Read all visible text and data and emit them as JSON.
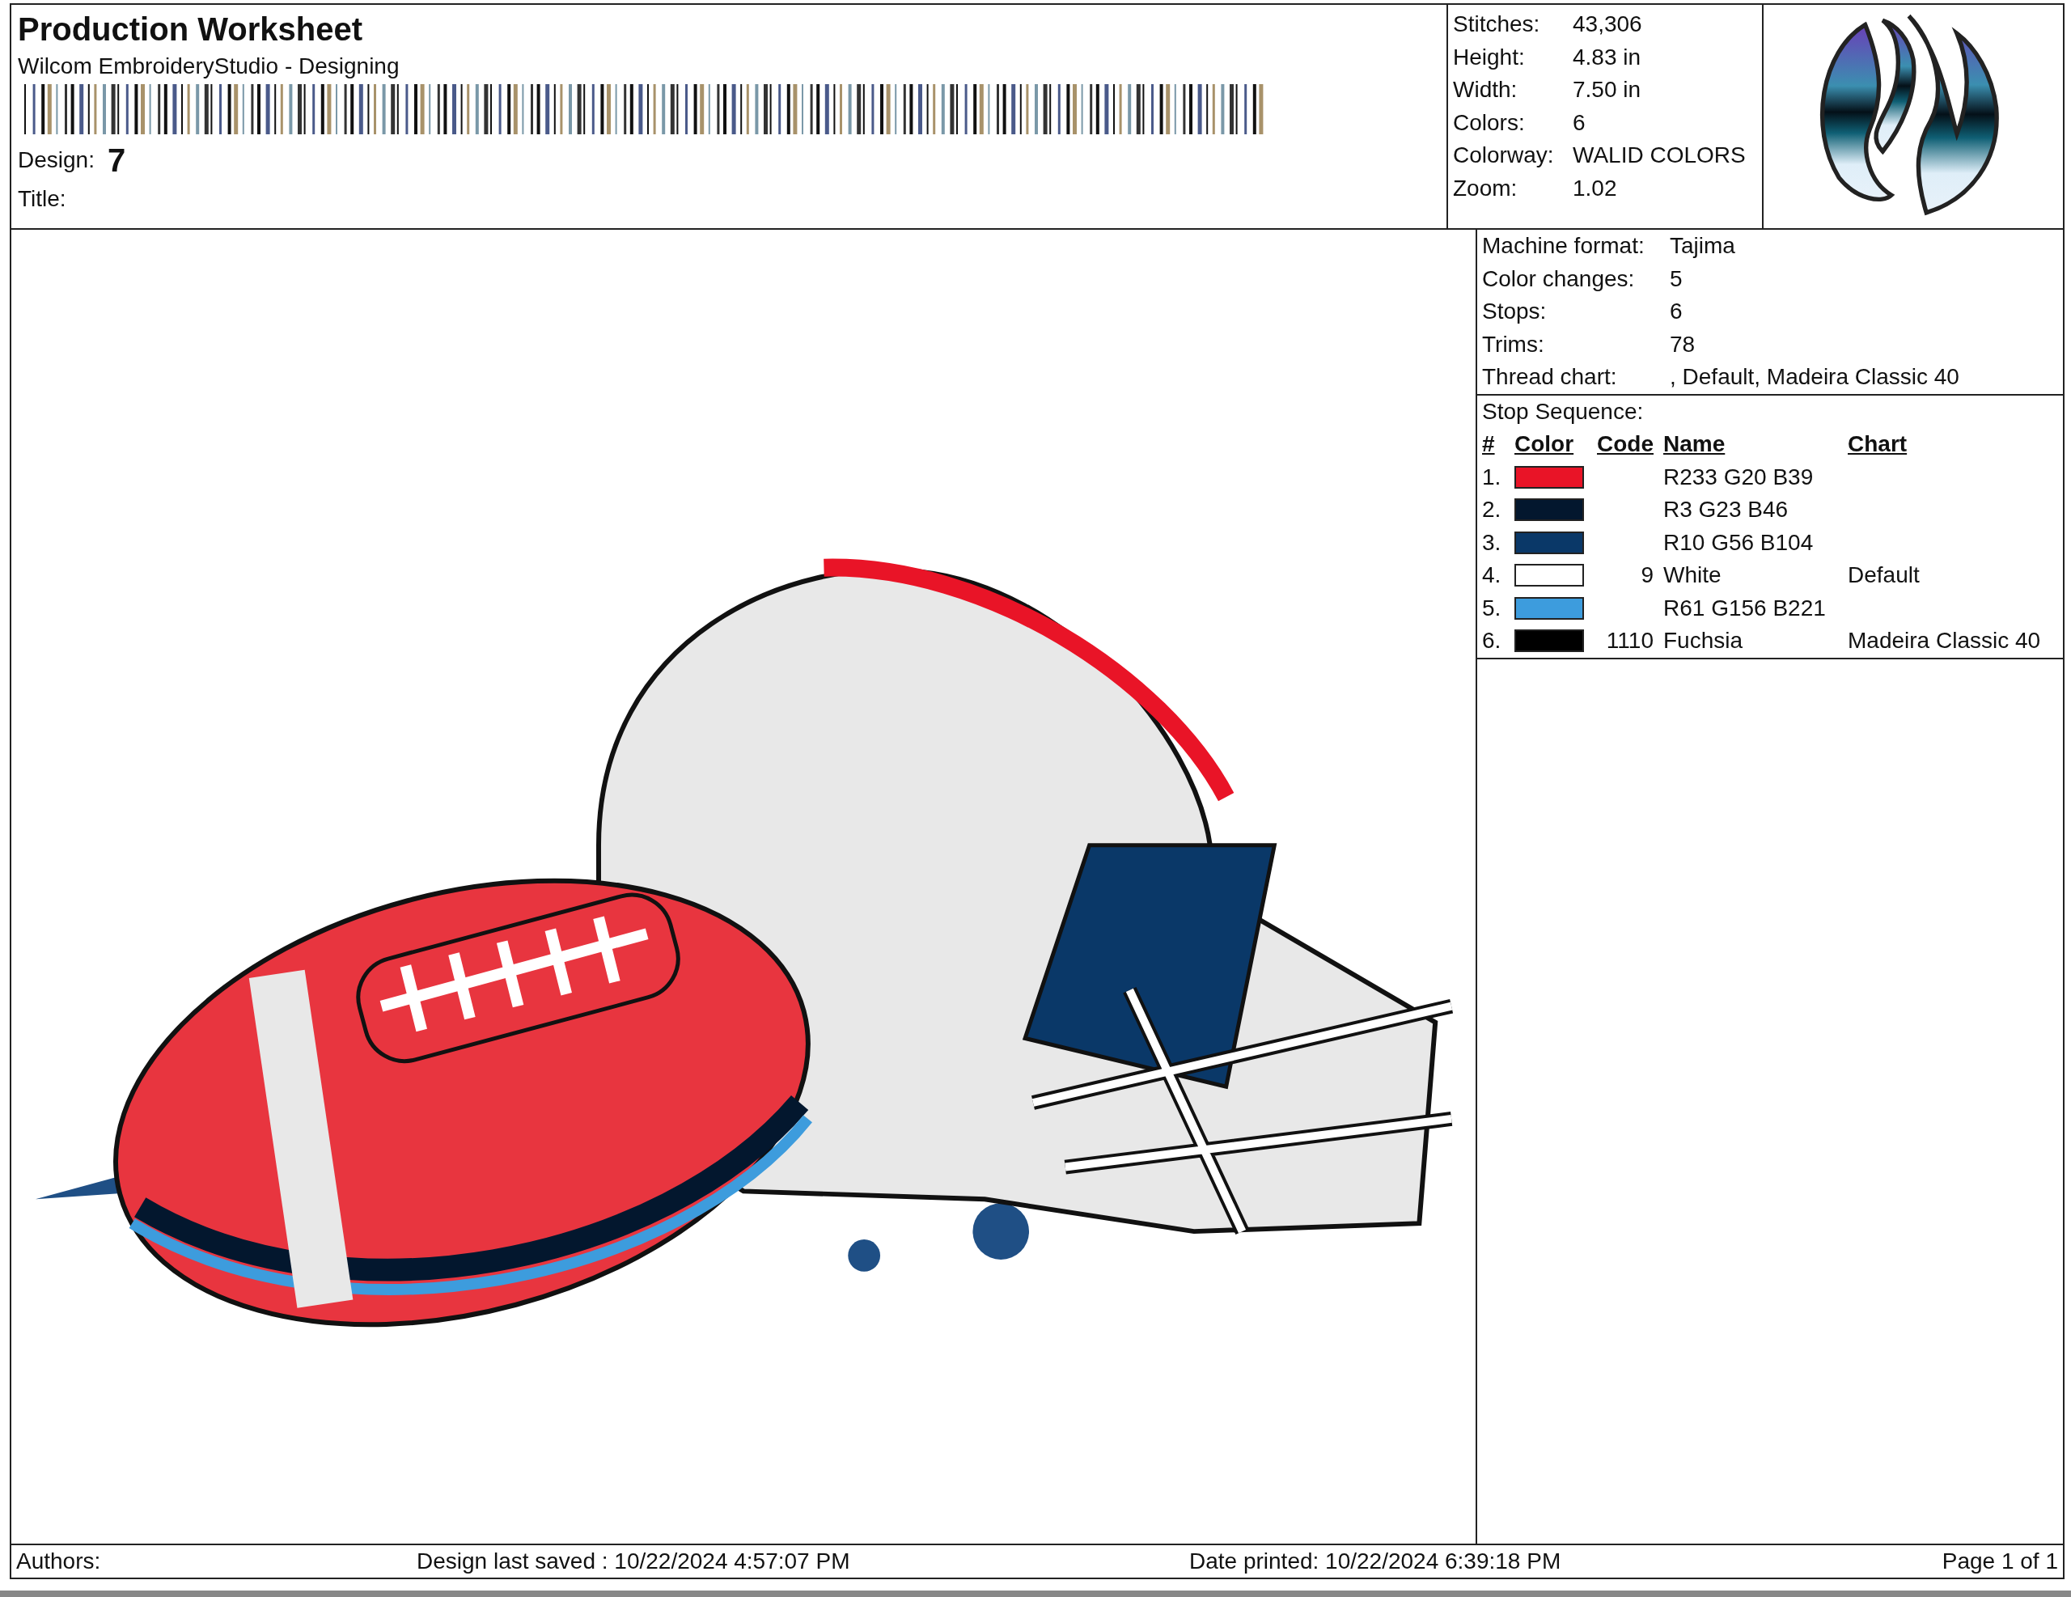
{
  "header": {
    "title": "Production Worksheet",
    "subtitle": "Wilcom EmbroideryStudio - Designing",
    "design_label": "Design:",
    "design_value": "7",
    "title_label": "Title:"
  },
  "stats": [
    {
      "label": "Stitches:",
      "value": "43,306"
    },
    {
      "label": "Height:",
      "value": "4.83 in"
    },
    {
      "label": "Width:",
      "value": "7.50 in"
    },
    {
      "label": "Colors:",
      "value": "6"
    },
    {
      "label": "Colorway:",
      "value": "WALID COLORS"
    },
    {
      "label": "Zoom:",
      "value": "1.02"
    }
  ],
  "machine": [
    {
      "label": "Machine format:",
      "value": "Tajima"
    },
    {
      "label": "Color changes:",
      "value": "5"
    },
    {
      "label": "Stops:",
      "value": "6"
    },
    {
      "label": "Trims:",
      "value": "78"
    },
    {
      "label": "Thread chart:",
      "value": ", Default, Madeira Classic 40"
    }
  ],
  "stop_sequence": {
    "title": "Stop Sequence:",
    "columns": [
      "#",
      "Color",
      "Code",
      "Name",
      "Chart"
    ],
    "rows": [
      {
        "number": "1.",
        "color": "#e91427",
        "name": "R233 G20 B39"
      },
      {
        "number": "2.",
        "color": "#03172e",
        "name": "R3 G23 B46"
      },
      {
        "number": "3.",
        "color": "#0a3868",
        "name": "R10 G56 B104"
      },
      {
        "number": "4.",
        "color": "#ffffff",
        "code": "9",
        "name": "White",
        "chart": "Default"
      },
      {
        "number": "5.",
        "color": "#3d9cdd",
        "name": "R61 G156 B221"
      },
      {
        "number": "6.",
        "color": "#000000",
        "code": "1110",
        "name": "Fuchsia",
        "chart": "Madeira Classic 40"
      }
    ]
  },
  "footer": {
    "authors": "Authors:",
    "saved": "Design last saved : 10/22/2024 4:57:07 PM",
    "printed": "Date printed: 10/22/2024 6:39:18 PM",
    "page": "Page 1 of 1"
  }
}
